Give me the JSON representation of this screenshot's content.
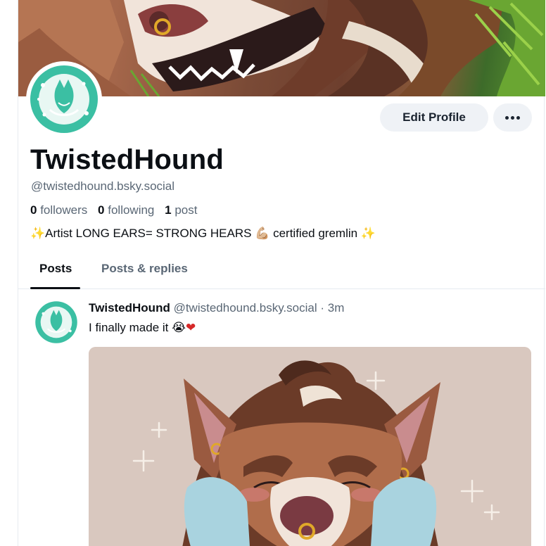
{
  "profile": {
    "display_name": "TwistedHound",
    "handle": "@twistedhound.bsky.social",
    "followers_count": "0",
    "followers_label": "followers",
    "following_count": "0",
    "following_label": "following",
    "posts_count": "1",
    "posts_label": "post",
    "bio_text": "Artist LONG EARS= STRONG HEARS 💪🏼 certified gremlin",
    "avatar_logo_text_top": "TWISTED",
    "avatar_logo_text_bottom": "HOUND"
  },
  "actions": {
    "edit_profile_label": "Edit Profile"
  },
  "tabs": [
    {
      "label": "Posts",
      "active": true
    },
    {
      "label": "Posts & replies",
      "active": false
    }
  ],
  "post": {
    "author_name": "TwistedHound",
    "author_handle": "@twistedhound.bsky.social",
    "separator": " · ",
    "time": "3m",
    "text": "I finally made it 😭",
    "heart": "❤"
  },
  "colors": {
    "accent_teal": "#3bbfa3",
    "button_bg": "#eff2f6",
    "muted_text": "#5a6775",
    "divider": "#e6ebf0",
    "heart": "#d62828"
  },
  "icons": {
    "more": "three-dots-horizontal-icon",
    "sparkle": "sparkles-icon"
  }
}
